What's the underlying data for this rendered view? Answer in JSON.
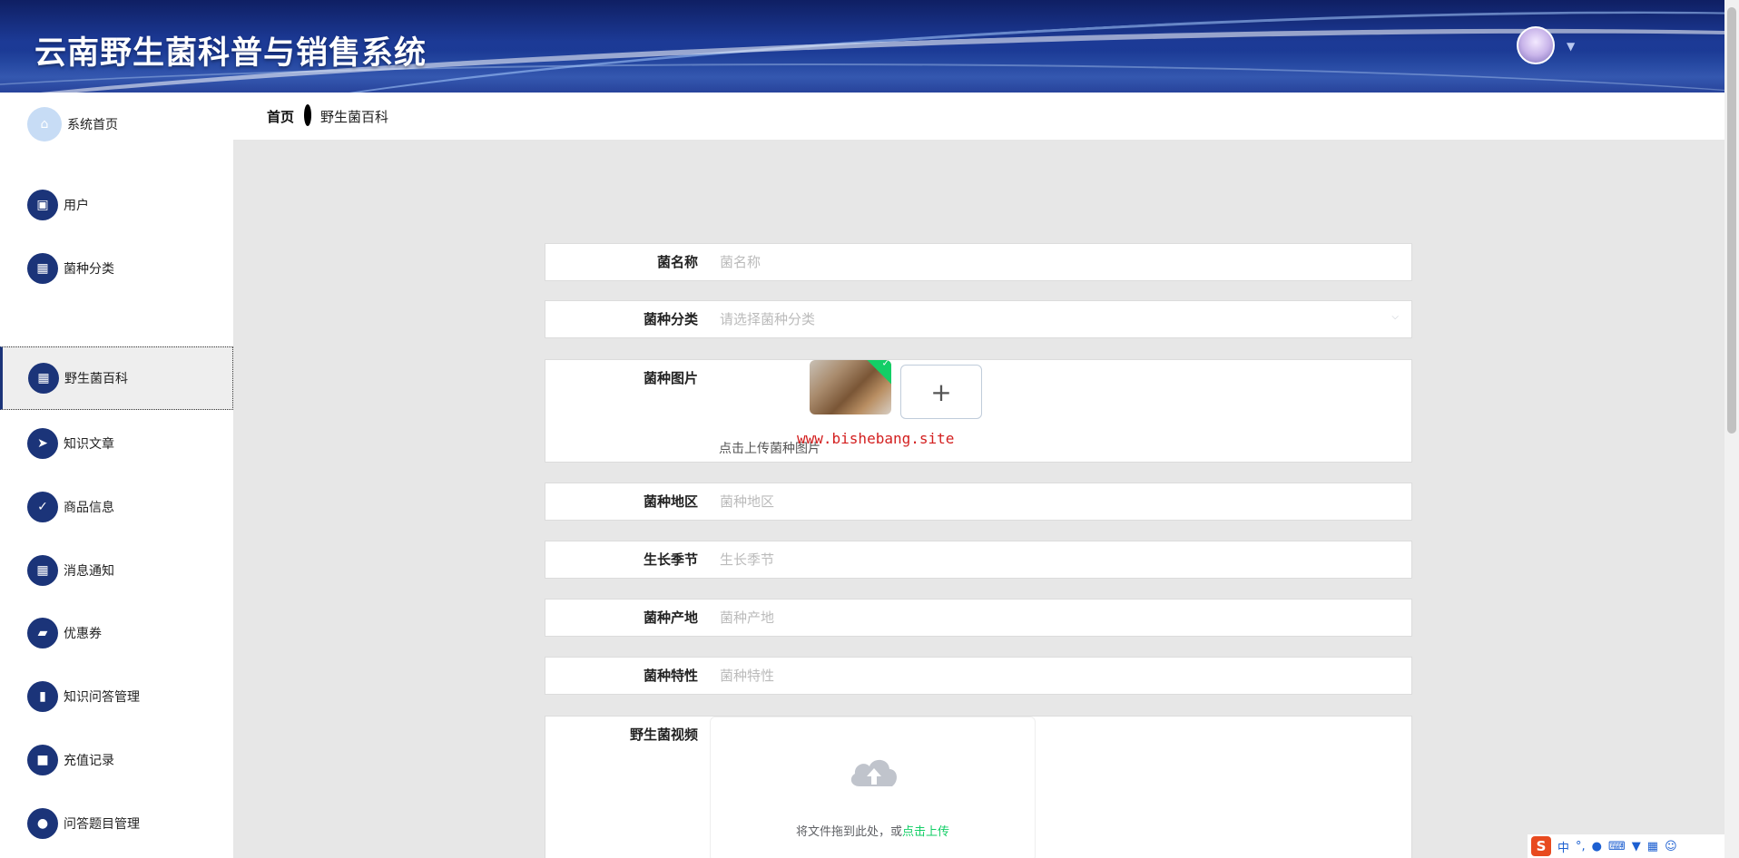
{
  "app": {
    "title": "云南野生菌科普与销售系统"
  },
  "breadcrumb": {
    "home": "首页",
    "current": "野生菌百科"
  },
  "sidebar": {
    "items": [
      {
        "label": "系统首页",
        "icon": "home-icon"
      },
      {
        "label": "用户",
        "icon": "user-doc-icon"
      },
      {
        "label": "菌种分类",
        "icon": "grid-icon"
      },
      {
        "label": "野生菌百科",
        "icon": "grid-icon"
      },
      {
        "label": "知识文章",
        "icon": "send-icon"
      },
      {
        "label": "商品信息",
        "icon": "clipboard-icon"
      },
      {
        "label": "消息通知",
        "icon": "grid-icon"
      },
      {
        "label": "优惠券",
        "icon": "wallet-icon"
      },
      {
        "label": "知识问答管理",
        "icon": "bar-chart-icon"
      },
      {
        "label": "充值记录",
        "icon": "briefcase-icon"
      },
      {
        "label": "问答题目管理",
        "icon": "person-icon"
      }
    ]
  },
  "form": {
    "name": {
      "label": "菌名称",
      "placeholder": "菌名称"
    },
    "category": {
      "label": "菌种分类",
      "placeholder": "请选择菌种分类"
    },
    "image": {
      "label": "菌种图片",
      "tip": "点击上传菌种图片"
    },
    "region": {
      "label": "菌种地区",
      "placeholder": "菌种地区"
    },
    "season": {
      "label": "生长季节",
      "placeholder": "生长季节"
    },
    "origin": {
      "label": "菌种产地",
      "placeholder": "菌种产地"
    },
    "trait": {
      "label": "菌种特性",
      "placeholder": "菌种特性"
    },
    "video": {
      "label": "野生菌视频",
      "drag_text": "将文件拖到此处，或",
      "click_text": "点击上传"
    }
  },
  "watermark": "www.bishebang.site",
  "tray": {
    "lang": "中"
  },
  "colors": {
    "sidebar_icon": "#1b3479",
    "accent_green": "#13ce66",
    "header_bg": "#1c3a96"
  }
}
